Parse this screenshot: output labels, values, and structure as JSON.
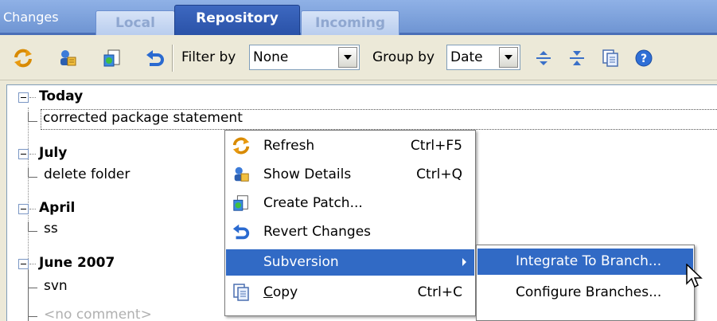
{
  "panel": {
    "title": "Changes",
    "tabs": [
      {
        "label": "Local",
        "active": false
      },
      {
        "label": "Repository",
        "active": true
      },
      {
        "label": "Incoming",
        "active": false
      }
    ]
  },
  "toolbar": {
    "icons": [
      "refresh-icon",
      "show-details-icon",
      "create-patch-icon",
      "revert-icon"
    ],
    "filter_label": "Filter by",
    "filter_value": "None",
    "group_label": "Group by",
    "group_value": "Date",
    "right_icons": [
      "expand-all-icon",
      "collapse-all-icon",
      "copy-icon",
      "help-icon"
    ]
  },
  "tree": {
    "groups": [
      {
        "label": "Today",
        "items": [
          "corrected package statement"
        ]
      },
      {
        "label": "July",
        "items": [
          "delete folder"
        ]
      },
      {
        "label": "April",
        "items": [
          "ss"
        ]
      },
      {
        "label": "June 2007",
        "items": [
          "svn",
          "<no comment>"
        ]
      }
    ]
  },
  "context_menu": {
    "items": [
      {
        "label": "Refresh",
        "shortcut": "Ctrl+F5",
        "icon": "refresh-icon"
      },
      {
        "label": "Show Details",
        "shortcut": "Ctrl+Q",
        "icon": "show-details-icon"
      },
      {
        "label": "Create Patch...",
        "shortcut": "",
        "icon": "create-patch-icon"
      },
      {
        "label": "Revert Changes",
        "shortcut": "",
        "icon": "revert-icon"
      },
      {
        "label": "Subversion",
        "shortcut": "",
        "icon": ""
      },
      {
        "label_pre": "",
        "label_mn": "C",
        "label_post": "opy",
        "shortcut": "Ctrl+C",
        "icon": "copy-icon"
      }
    ],
    "highlighted": "Subversion"
  },
  "submenu": {
    "items": [
      {
        "label": "Integrate To Branch..."
      },
      {
        "label": "Configure Branches..."
      }
    ],
    "highlighted": "Integrate To Branch..."
  },
  "colors": {
    "selection": "#316ac5",
    "tab_active": "#2a52a8",
    "tab_inactive_text": "#8fa7d0"
  }
}
